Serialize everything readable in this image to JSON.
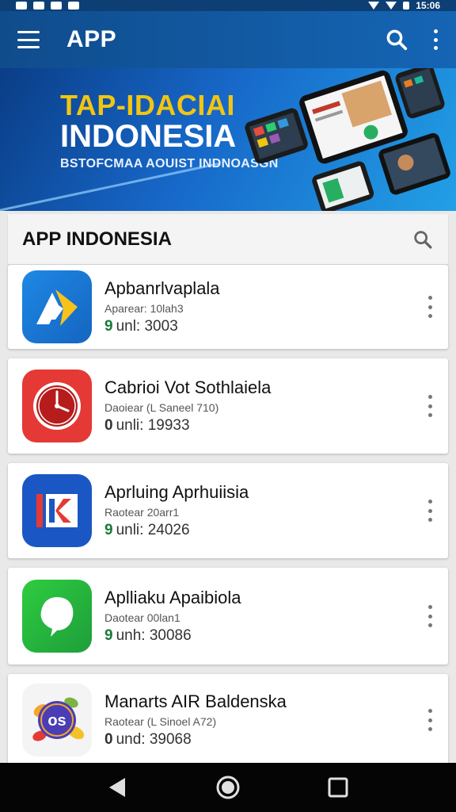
{
  "status_bar": {
    "time": "15:06"
  },
  "app_bar": {
    "title": "APP"
  },
  "banner": {
    "line1": "TAP-IDACIAI",
    "line2": "INDONESIA",
    "line3": "BSTOFCMAA AOUIST INDNOASGN"
  },
  "section": {
    "title": "APP INDONESIA"
  },
  "apps": [
    {
      "name": "Apbanrlvaplala",
      "developer": "Aparear: 10lah3",
      "downloads_prefix": "9",
      "downloads": "unl: 3003",
      "icon": "play-arrow-icon",
      "color": "#1e7fdc"
    },
    {
      "name": "Cabrioi Vot Sothlaiela",
      "developer": "Daoiear (L Saneel 710)",
      "downloads_prefix": "0",
      "downloads": "unli: 19933",
      "icon": "clock-icon",
      "color": "#e02424"
    },
    {
      "name": "Aprluing Aprhuiisia",
      "developer": "Raotear 20arr1",
      "downloads_prefix": "9",
      "downloads": "unli: 24026",
      "icon": "ik-logo-icon",
      "color": "#1a57c4"
    },
    {
      "name": "Aplliaku Apaibiola",
      "developer": "Daotear 00lan1",
      "downloads_prefix": "9",
      "downloads": "unh: 30086",
      "icon": "chat-bubble-icon",
      "color": "#22b04a"
    },
    {
      "name": "Manarts AIR Baldenska",
      "developer": "Raotear (L Sinoel A72)",
      "downloads_prefix": "0",
      "downloads": "und: 39068",
      "icon": "os-badge-icon",
      "color": "#4b3db5"
    }
  ]
}
